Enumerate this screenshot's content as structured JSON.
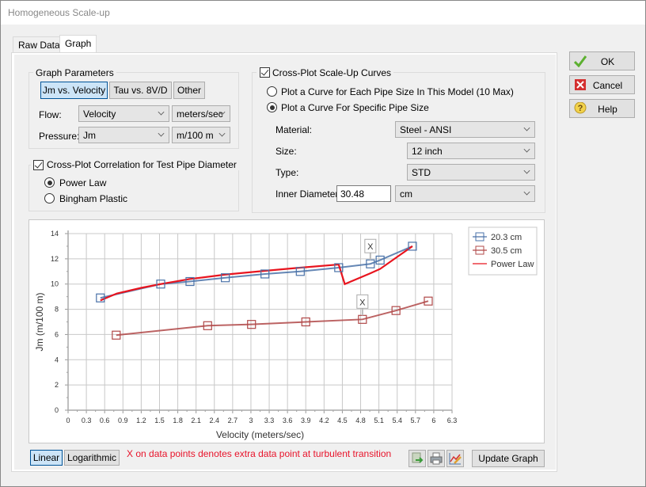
{
  "window": {
    "title": "Homogeneous Scale-up"
  },
  "tabs": [
    {
      "label": "Raw Data",
      "active": false
    },
    {
      "label": "Graph",
      "active": true
    }
  ],
  "side_buttons": {
    "ok": "OK",
    "cancel": "Cancel",
    "help": "Help"
  },
  "graph_parameters": {
    "title": "Graph Parameters",
    "buttons": [
      {
        "label": "Jm vs. Velocity",
        "selected": true
      },
      {
        "label": "Tau vs. 8V/D",
        "selected": false
      },
      {
        "label": "Other",
        "selected": false
      }
    ],
    "flow_label": "Flow:",
    "flow_value": "Velocity",
    "flow_unit": "meters/sec",
    "pressure_label": "Pressure:",
    "pressure_value": "Jm",
    "pressure_unit": "m/100 m"
  },
  "correlation": {
    "title": "Cross-Plot Correlation for Test Pipe Diameter",
    "checked": true,
    "options": [
      {
        "label": "Power Law",
        "selected": true
      },
      {
        "label": "Bingham Plastic",
        "selected": false
      }
    ]
  },
  "scaleup": {
    "title": "Cross-Plot Scale-Up Curves",
    "checked": true,
    "options": [
      {
        "label": "Plot a Curve for Each Pipe Size In This Model (10 Max)",
        "selected": false
      },
      {
        "label": "Plot a Curve For Specific Pipe Size",
        "selected": true
      }
    ],
    "material_label": "Material:",
    "material_value": "Steel - ANSI",
    "size_label": "Size:",
    "size_value": "12 inch",
    "type_label": "Type:",
    "type_value": "STD",
    "inner_diameter_label": "Inner Diameter:",
    "inner_diameter_value": "30.48",
    "inner_diameter_unit": "cm"
  },
  "bottom": {
    "linear": "Linear",
    "logarithmic": "Logarithmic",
    "scale_selected": "Linear",
    "note": "X on data points denotes extra data point at turbulent transition",
    "update_graph": "Update Graph"
  },
  "colors": {
    "series_20": "#4a72a8",
    "series_30": "#b04848",
    "power_law": "#e8141e",
    "note": "#e8132a"
  },
  "chart_data": {
    "type": "line",
    "title": "",
    "xlabel": "Velocity (meters/sec)",
    "ylabel": "Jm (m/100 m)",
    "xlim": [
      0,
      6.3
    ],
    "ylim": [
      0,
      14
    ],
    "xticks": [
      "0",
      "0.3",
      "0.6",
      "0.9",
      "1.2",
      "1.5",
      "1.8",
      "2.1",
      "2.4",
      "2.7",
      "3",
      "3.3",
      "3.6",
      "3.9",
      "4.2",
      "4.5",
      "4.8",
      "5.1",
      "5.4",
      "5.7",
      "6",
      "6.3"
    ],
    "yticks": [
      "0",
      "2",
      "4",
      "6",
      "8",
      "10",
      "12",
      "14"
    ],
    "grid": true,
    "legend": "top-right",
    "series": [
      {
        "name": "20.3 cm",
        "marker": "square",
        "x": [
          0.53,
          1.52,
          2.0,
          2.58,
          3.23,
          3.81,
          4.44,
          4.96,
          5.12,
          5.65
        ],
        "y": [
          8.9,
          10.0,
          10.2,
          10.5,
          10.8,
          11.0,
          11.3,
          11.6,
          11.9,
          13.0
        ],
        "transition_x_index": 7
      },
      {
        "name": "30.5 cm",
        "marker": "square",
        "x": [
          0.79,
          2.29,
          3.01,
          3.9,
          4.83,
          5.38,
          5.91
        ],
        "y": [
          5.95,
          6.7,
          6.8,
          7.0,
          7.2,
          7.9,
          8.65
        ],
        "transition_x_index": 4
      },
      {
        "name": "Power Law",
        "marker": "none",
        "x": [
          0.53,
          0.8,
          1.2,
          1.52,
          2.0,
          2.58,
          3.23,
          3.81,
          4.44,
          4.54,
          4.96,
          5.12,
          5.65
        ],
        "y": [
          8.7,
          9.25,
          9.7,
          10.0,
          10.4,
          10.75,
          11.05,
          11.3,
          11.55,
          10.0,
          10.85,
          11.2,
          13.0
        ]
      }
    ],
    "annotation_marker": "X"
  }
}
